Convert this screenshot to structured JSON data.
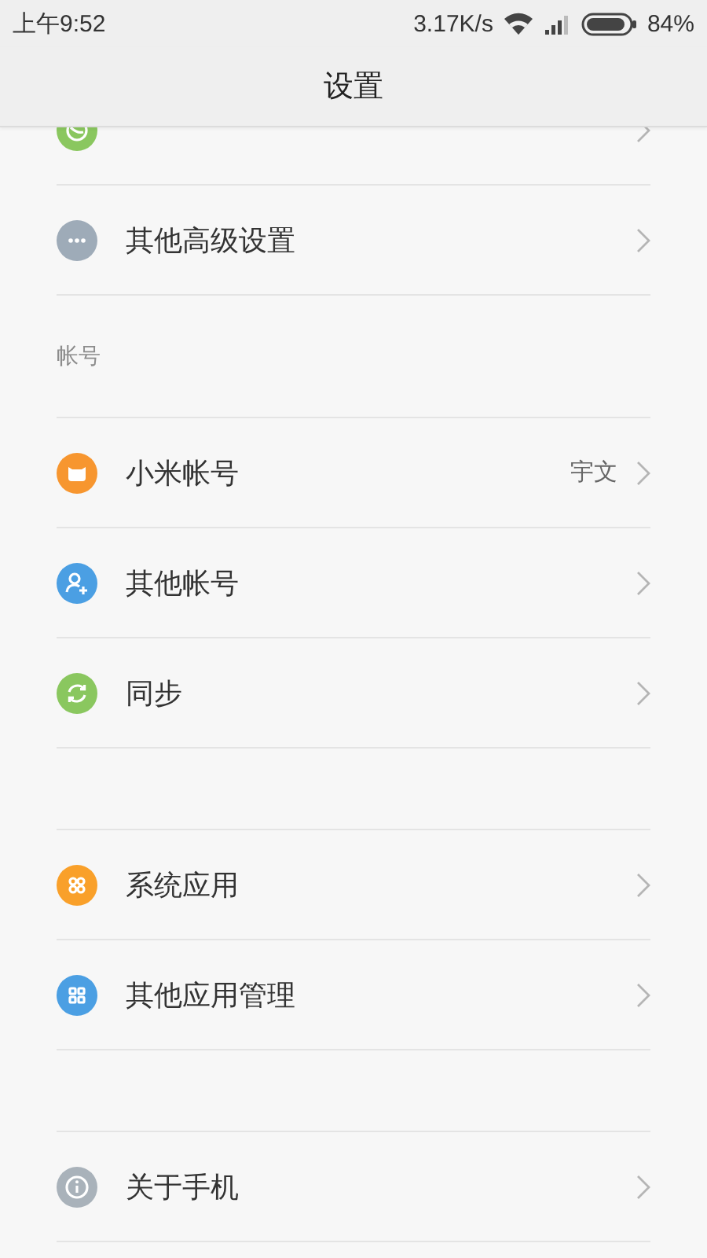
{
  "status_bar": {
    "time": "上午9:52",
    "net_speed": "3.17K/s",
    "battery": "84%"
  },
  "title": "设置",
  "sections": [
    {
      "items": [
        {
          "kind": "child",
          "color": "#8ac75f"
        },
        {
          "kind": "dots",
          "color": "#9eabb8",
          "label": "其他高级设置"
        }
      ]
    },
    {
      "header": "帐号",
      "items": [
        {
          "kind": "face",
          "color": "#f7962f",
          "label": "小米帐号",
          "value": "宇文"
        },
        {
          "kind": "person",
          "color": "#4b9fe3",
          "label": "其他帐号"
        },
        {
          "kind": "sync",
          "color": "#8ac75f",
          "label": "同步"
        }
      ]
    },
    {
      "items": [
        {
          "kind": "circles",
          "color": "#f9a02a",
          "label": "系统应用"
        },
        {
          "kind": "grid",
          "color": "#4b9fe3",
          "label": "其他应用管理"
        }
      ]
    },
    {
      "items": [
        {
          "kind": "info",
          "color": "#a9b2ba",
          "label": "关于手机"
        }
      ]
    }
  ]
}
